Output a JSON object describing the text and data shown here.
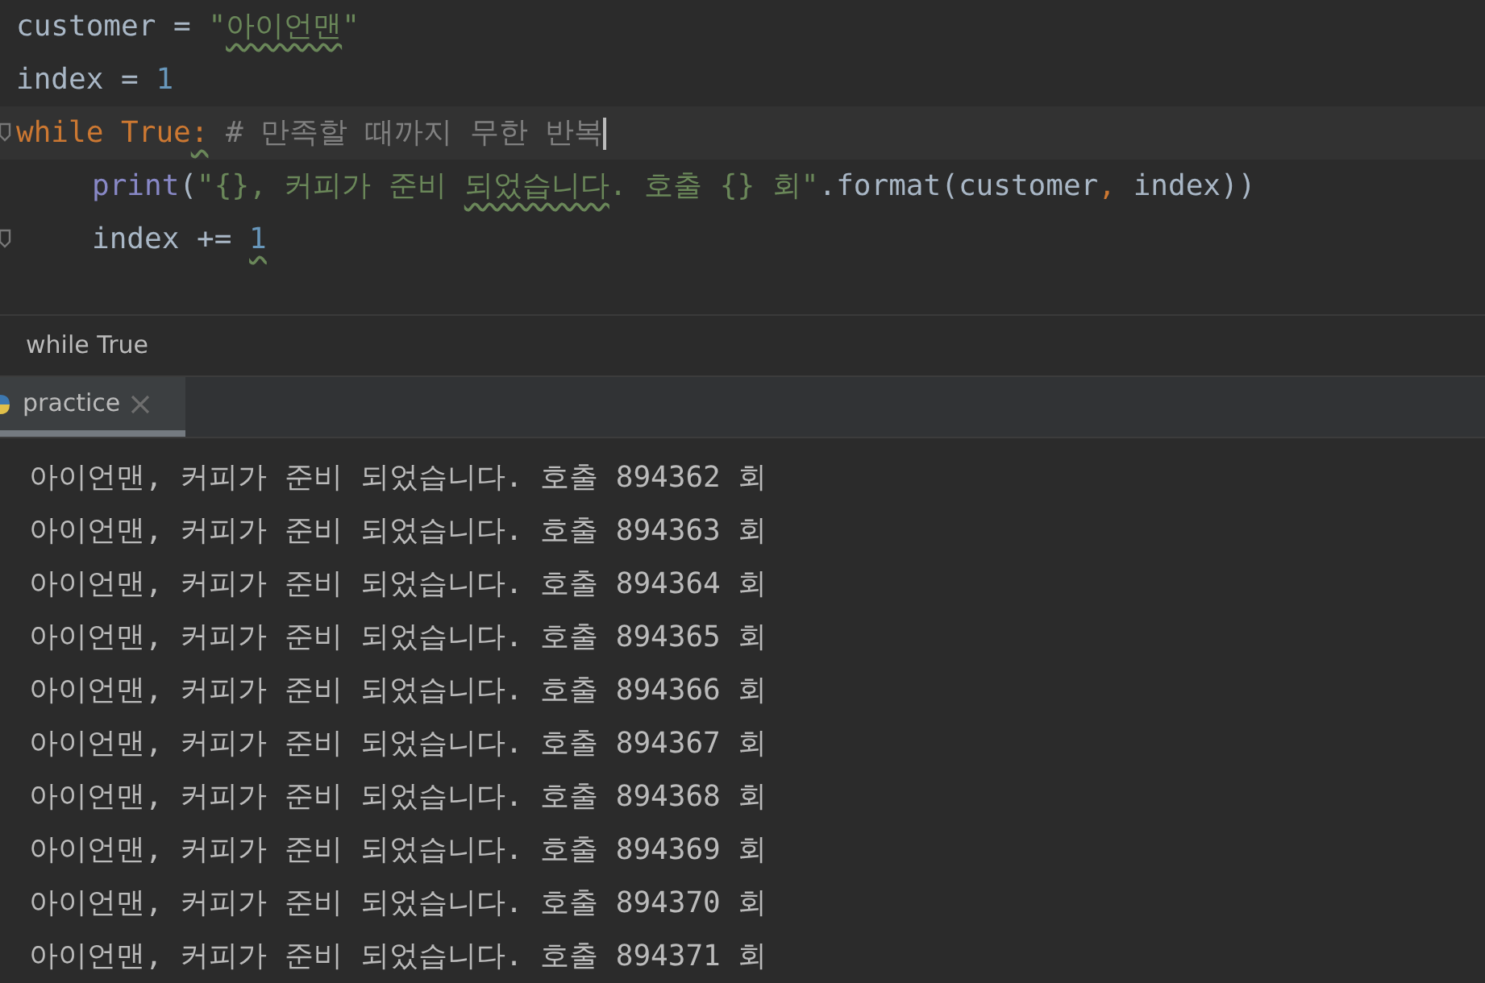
{
  "editor": {
    "lines": [
      {
        "current": false,
        "fold": false,
        "tokens": [
          {
            "text": "customer = ",
            "kind": "plain"
          },
          {
            "text": "\"",
            "kind": "string"
          },
          {
            "text": "아이언맨",
            "kind": "string",
            "squiggle": true
          },
          {
            "text": "\"",
            "kind": "string"
          }
        ]
      },
      {
        "current": false,
        "fold": false,
        "tokens": [
          {
            "text": "index = ",
            "kind": "plain"
          },
          {
            "text": "1",
            "kind": "number"
          }
        ]
      },
      {
        "current": true,
        "fold": true,
        "tokens": [
          {
            "text": "while True",
            "kind": "keyword"
          },
          {
            "text": ":",
            "kind": "keyword",
            "squiggle": true
          },
          {
            "text": " # 만족할 때까지 무한 반복",
            "kind": "comment"
          }
        ],
        "children": [
          {
            "current": false,
            "fold": false,
            "tokens": [
              {
                "text": "print",
                "kind": "builtin"
              },
              {
                "text": "(",
                "kind": "plain"
              },
              {
                "text": "\"{}, 커피가 준비 ",
                "kind": "string"
              },
              {
                "text": "되었습니다",
                "kind": "string",
                "squiggle": true
              },
              {
                "text": ". 호출 {} 회\"",
                "kind": "string"
              },
              {
                "text": ".format(customer",
                "kind": "plain"
              },
              {
                "text": ",",
                "kind": "keyword"
              },
              {
                "text": " index))",
                "kind": "plain"
              }
            ]
          },
          {
            "current": false,
            "fold": true,
            "tokens": [
              {
                "text": "index += ",
                "kind": "plain"
              },
              {
                "text": "1",
                "kind": "number",
                "squiggle": true
              }
            ]
          }
        ]
      }
    ]
  },
  "breadcrumb": "while True",
  "tabs": [
    {
      "label": "practice",
      "selected": true
    }
  ],
  "console": {
    "lines": [
      "아이언맨, 커피가 준비 되었습니다. 호출 894362 회",
      "아이언맨, 커피가 준비 되었습니다. 호출 894363 회",
      "아이언맨, 커피가 준비 되었습니다. 호출 894364 회",
      "아이언맨, 커피가 준비 되었습니다. 호출 894365 회",
      "아이언맨, 커피가 준비 되었습니다. 호출 894366 회",
      "아이언맨, 커피가 준비 되었습니다. 호출 894367 회",
      "아이언맨, 커피가 준비 되었습니다. 호출 894368 회",
      "아이언맨, 커피가 준비 되었습니다. 호출 894369 회",
      "아이언맨, 커피가 준비 되었습니다. 호출 894370 회",
      "아이언맨, 커피가 준비 되었습니다. 호출 894371 회"
    ]
  }
}
